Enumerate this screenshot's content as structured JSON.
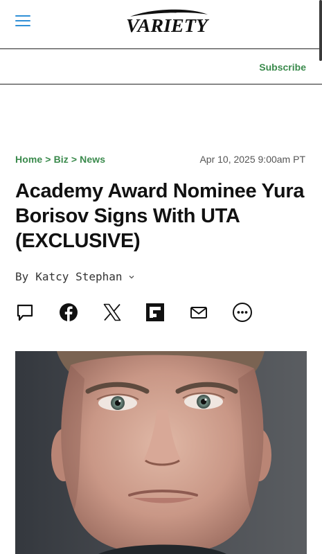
{
  "header": {
    "logo_text": "VARIETY",
    "menu_icon": "hamburger-menu-icon",
    "subscribe_label": "Subscribe"
  },
  "breadcrumb": {
    "items": [
      "Home",
      "Biz",
      "News"
    ],
    "separator": ">"
  },
  "dateline": "Apr 10, 2025 9:00am PT",
  "article": {
    "headline": "Academy Award Nominee Yura Borisov Signs With UTA (EXCLUSIVE)",
    "byline_prefix": "By",
    "author": "Katcy Stephan"
  },
  "share_icons": [
    "comment-icon",
    "facebook-icon",
    "x-icon",
    "flipboard-icon",
    "email-icon",
    "more-icon"
  ],
  "colors": {
    "accent_green": "#3a8a4c",
    "menu_blue": "#2f8fd6",
    "text": "#111111"
  }
}
